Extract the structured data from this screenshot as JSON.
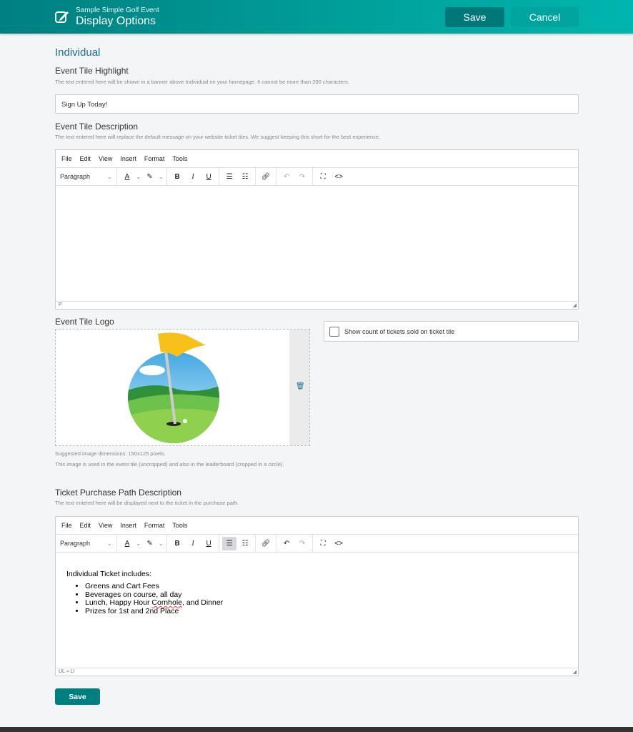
{
  "header": {
    "event_name": "Sample Simple Golf Event",
    "title": "Display Options",
    "save": "Save",
    "cancel": "Cancel"
  },
  "section_title": "Individual",
  "highlight": {
    "label": "Event Tile Highlight",
    "hint": "The text entered here will be shown in a banner above Individual on your homepage. It cannot be more than 200 characters.",
    "value": "Sign Up Today!"
  },
  "description": {
    "label": "Event Tile Description",
    "hint": "The text entered here will replace the default message on your website ticket tiles. We suggest keeping this short for the best experience.",
    "status": "P"
  },
  "editor": {
    "menu": [
      "File",
      "Edit",
      "View",
      "Insert",
      "Format",
      "Tools"
    ],
    "block_format": "Paragraph"
  },
  "logo": {
    "label": "Event Tile Logo",
    "hint1": "Suggested image dimensions: 150x125 pixels.",
    "hint2": "This image is used in the event tile (uncropped) and also in the leaderboard (cropped in a circle)."
  },
  "show_count": {
    "label": "Show count of tickets sold on ticket tile",
    "checked": false
  },
  "purchase": {
    "label": "Ticket Purchase Path Description",
    "hint": "The text entered here will be displayed next to the ticket in the purchase path.",
    "heading": "Individual Ticket includes:",
    "items": [
      "Greens and Cart Fees",
      "Beverages on course, all day",
      "Lunch, Happy Hour ",
      "Cornhole",
      ", and Dinner",
      "Prizes for 1st and 2nd Place"
    ],
    "status": "UL » LI"
  },
  "footer": {
    "save": "Save"
  }
}
